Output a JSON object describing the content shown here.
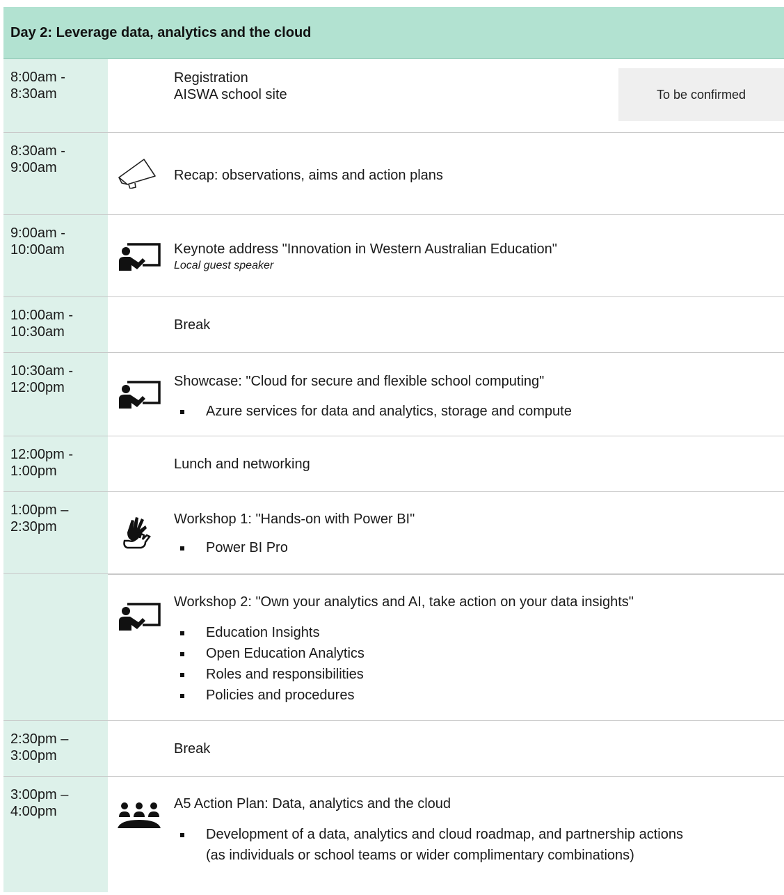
{
  "header": {
    "title": "Day 2: Leverage data, analytics and the cloud"
  },
  "rows": [
    {
      "time": "8:00am -\n8:30am",
      "title": "Registration",
      "subtitle": "AISWA school site",
      "badge": "To be confirmed"
    },
    {
      "time": "8:30am -\n9:00am",
      "icon": "megaphone-icon",
      "title": "Recap: observations, aims and action plans"
    },
    {
      "time": "9:00am -\n10:00am",
      "icon": "presenter-board-icon",
      "title": "Keynote address \"Innovation in Western Australian Education\"",
      "note": "Local guest speaker"
    },
    {
      "time": "10:00am -\n10:30am",
      "title": "Break"
    },
    {
      "time": "10:30am -\n12:00pm",
      "icon": "presenter-board-icon",
      "title": "Showcase: \"Cloud for secure and flexible school computing\"",
      "bullets": [
        "Azure services for data and analytics, storage and compute"
      ]
    },
    {
      "time": "12:00pm -\n1:00pm",
      "title": "Lunch and networking"
    },
    {
      "time": "1:00pm –\n2:30pm",
      "icon": "hands-on-icon",
      "title": "Workshop 1: \"Hands-on with Power BI\"",
      "bullets": [
        "Power BI Pro"
      ]
    },
    {
      "time": "",
      "icon": "presenter-board-icon",
      "title": "Workshop 2: \"Own your analytics and AI, take action on your data insights\"",
      "bullets": [
        "Education Insights",
        "Open Education Analytics",
        "Roles and responsibilities",
        "Policies and procedures"
      ]
    },
    {
      "time": "2:30pm –\n3:00pm",
      "title": "Break"
    },
    {
      "time": "3:00pm –\n4:00pm",
      "icon": "group-meeting-icon",
      "title": "A5 Action Plan: Data, analytics and the cloud",
      "bullets": [
        "Development of a data, analytics and cloud roadmap, and partnership actions (as individuals or school teams or wider complimentary combinations)"
      ]
    }
  ]
}
